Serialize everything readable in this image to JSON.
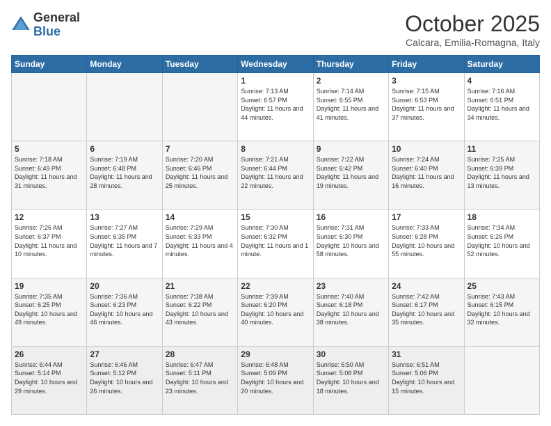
{
  "logo": {
    "general": "General",
    "blue": "Blue"
  },
  "title": "October 2025",
  "subtitle": "Calcara, Emilia-Romagna, Italy",
  "headers": [
    "Sunday",
    "Monday",
    "Tuesday",
    "Wednesday",
    "Thursday",
    "Friday",
    "Saturday"
  ],
  "weeks": [
    {
      "days": [
        {
          "num": "",
          "info": ""
        },
        {
          "num": "",
          "info": ""
        },
        {
          "num": "",
          "info": ""
        },
        {
          "num": "1",
          "info": "Sunrise: 7:13 AM\nSunset: 6:57 PM\nDaylight: 11 hours and 44 minutes."
        },
        {
          "num": "2",
          "info": "Sunrise: 7:14 AM\nSunset: 6:55 PM\nDaylight: 11 hours and 41 minutes."
        },
        {
          "num": "3",
          "info": "Sunrise: 7:15 AM\nSunset: 6:53 PM\nDaylight: 11 hours and 37 minutes."
        },
        {
          "num": "4",
          "info": "Sunrise: 7:16 AM\nSunset: 6:51 PM\nDaylight: 11 hours and 34 minutes."
        }
      ]
    },
    {
      "days": [
        {
          "num": "5",
          "info": "Sunrise: 7:18 AM\nSunset: 6:49 PM\nDaylight: 11 hours and 31 minutes."
        },
        {
          "num": "6",
          "info": "Sunrise: 7:19 AM\nSunset: 6:48 PM\nDaylight: 11 hours and 28 minutes."
        },
        {
          "num": "7",
          "info": "Sunrise: 7:20 AM\nSunset: 6:46 PM\nDaylight: 11 hours and 25 minutes."
        },
        {
          "num": "8",
          "info": "Sunrise: 7:21 AM\nSunset: 6:44 PM\nDaylight: 11 hours and 22 minutes."
        },
        {
          "num": "9",
          "info": "Sunrise: 7:22 AM\nSunset: 6:42 PM\nDaylight: 11 hours and 19 minutes."
        },
        {
          "num": "10",
          "info": "Sunrise: 7:24 AM\nSunset: 6:40 PM\nDaylight: 11 hours and 16 minutes."
        },
        {
          "num": "11",
          "info": "Sunrise: 7:25 AM\nSunset: 6:39 PM\nDaylight: 11 hours and 13 minutes."
        }
      ]
    },
    {
      "days": [
        {
          "num": "12",
          "info": "Sunrise: 7:26 AM\nSunset: 6:37 PM\nDaylight: 11 hours and 10 minutes."
        },
        {
          "num": "13",
          "info": "Sunrise: 7:27 AM\nSunset: 6:35 PM\nDaylight: 11 hours and 7 minutes."
        },
        {
          "num": "14",
          "info": "Sunrise: 7:29 AM\nSunset: 6:33 PM\nDaylight: 11 hours and 4 minutes."
        },
        {
          "num": "15",
          "info": "Sunrise: 7:30 AM\nSunset: 6:32 PM\nDaylight: 11 hours and 1 minute."
        },
        {
          "num": "16",
          "info": "Sunrise: 7:31 AM\nSunset: 6:30 PM\nDaylight: 10 hours and 58 minutes."
        },
        {
          "num": "17",
          "info": "Sunrise: 7:33 AM\nSunset: 6:28 PM\nDaylight: 10 hours and 55 minutes."
        },
        {
          "num": "18",
          "info": "Sunrise: 7:34 AM\nSunset: 6:26 PM\nDaylight: 10 hours and 52 minutes."
        }
      ]
    },
    {
      "days": [
        {
          "num": "19",
          "info": "Sunrise: 7:35 AM\nSunset: 6:25 PM\nDaylight: 10 hours and 49 minutes."
        },
        {
          "num": "20",
          "info": "Sunrise: 7:36 AM\nSunset: 6:23 PM\nDaylight: 10 hours and 46 minutes."
        },
        {
          "num": "21",
          "info": "Sunrise: 7:38 AM\nSunset: 6:22 PM\nDaylight: 10 hours and 43 minutes."
        },
        {
          "num": "22",
          "info": "Sunrise: 7:39 AM\nSunset: 6:20 PM\nDaylight: 10 hours and 40 minutes."
        },
        {
          "num": "23",
          "info": "Sunrise: 7:40 AM\nSunset: 6:18 PM\nDaylight: 10 hours and 38 minutes."
        },
        {
          "num": "24",
          "info": "Sunrise: 7:42 AM\nSunset: 6:17 PM\nDaylight: 10 hours and 35 minutes."
        },
        {
          "num": "25",
          "info": "Sunrise: 7:43 AM\nSunset: 6:15 PM\nDaylight: 10 hours and 32 minutes."
        }
      ]
    },
    {
      "days": [
        {
          "num": "26",
          "info": "Sunrise: 6:44 AM\nSunset: 5:14 PM\nDaylight: 10 hours and 29 minutes."
        },
        {
          "num": "27",
          "info": "Sunrise: 6:46 AM\nSunset: 5:12 PM\nDaylight: 10 hours and 26 minutes."
        },
        {
          "num": "28",
          "info": "Sunrise: 6:47 AM\nSunset: 5:11 PM\nDaylight: 10 hours and 23 minutes."
        },
        {
          "num": "29",
          "info": "Sunrise: 6:48 AM\nSunset: 5:09 PM\nDaylight: 10 hours and 20 minutes."
        },
        {
          "num": "30",
          "info": "Sunrise: 6:50 AM\nSunset: 5:08 PM\nDaylight: 10 hours and 18 minutes."
        },
        {
          "num": "31",
          "info": "Sunrise: 6:51 AM\nSunset: 5:06 PM\nDaylight: 10 hours and 15 minutes."
        },
        {
          "num": "",
          "info": ""
        }
      ]
    }
  ]
}
